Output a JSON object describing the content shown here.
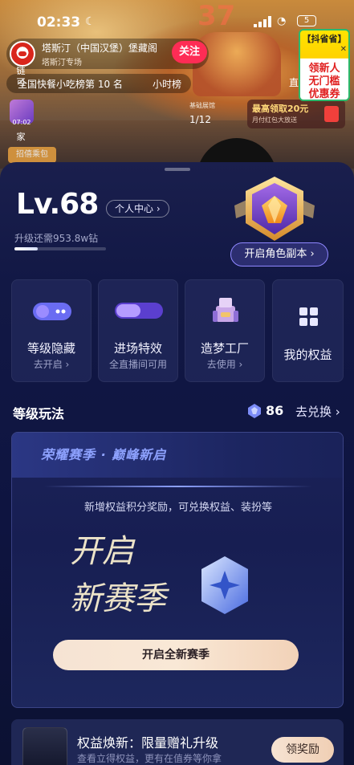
{
  "status_bar": {
    "time": "02:33",
    "battery": "5"
  },
  "stream": {
    "host_name": "塔斯汀（中国汉堡）堡藏阁",
    "host_sub": "塔斯汀专场",
    "follow_label": "关注",
    "rank_text": "全国快餐小吃榜第 10 名",
    "hourly_label": "小时榜",
    "straight_label": "直播",
    "big_price": "37",
    "side_top": "链\n可",
    "side_thumb_time": "07:02",
    "side_bottom": "家",
    "kitchen_tag": "招僖乘包",
    "base_show": "基础展馆",
    "page_counter": "1/12",
    "redpack_title": "最高领取20元",
    "redpack_sub": "月付红包大放送",
    "promo_top": "【抖省省】",
    "promo_main": "领新人\n无门槛\n优惠券"
  },
  "sheet": {
    "level": "Lv.68",
    "personal_center": "个人中心 ›",
    "upgrade_text": "升级还需953.8w钻",
    "progress_fraction": 0.25,
    "dungeon_button": "开启角色副本 ›"
  },
  "features": [
    {
      "title": "等级隐藏",
      "sub": "去开启 ›",
      "icon": "hidden-toggle-icon"
    },
    {
      "title": "进场特效",
      "sub": "全直播间可用",
      "icon": "entrance-effect-icon"
    },
    {
      "title": "造梦工厂",
      "sub": "去使用 ›",
      "icon": "dream-factory-icon"
    },
    {
      "title": "我的权益",
      "sub": "",
      "icon": "grid-icon"
    }
  ],
  "play": {
    "section_title": "等级玩法",
    "gem_count": "86",
    "exchange_label": "去兑换 ›"
  },
  "season": {
    "banner": "荣耀赛季 · 巅峰新启",
    "description": "新增权益积分奖励，可兑换权益、装扮等",
    "art_line1": "开启",
    "art_line2": "新赛季",
    "cta": "开启全新赛季"
  },
  "bottom_card": {
    "title": "权益焕新：限量赠礼升级",
    "subtitle": "查看立得权益，更有在值券等你拿",
    "button": "领奖励"
  },
  "colors": {
    "sheet_bg": "#121845",
    "accent_purple": "#8f87ff",
    "follow_red": "#fe2c55",
    "cta_cream": "#f6e3d3"
  }
}
